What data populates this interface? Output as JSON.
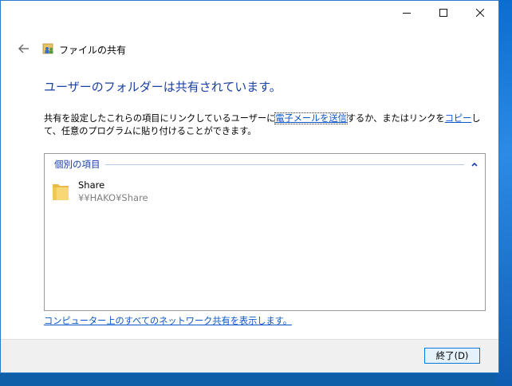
{
  "window": {
    "app_title": "ファイルの共有",
    "controls": {
      "minimize": "minimize",
      "maximize": "maximize",
      "close": "close"
    }
  },
  "main": {
    "heading": "ユーザーのフォルダーは共有されています。",
    "description": {
      "part1": "共有を設定したこれらの項目にリンクしているユーザーに",
      "email_link": "電子メールを送信",
      "part2": "するか、またはリンクを",
      "copy_link": "コピー",
      "part3": "して、任意のプログラムに貼り付けることができます。"
    },
    "group": {
      "label": "個別の項目",
      "items": [
        {
          "name": "Share",
          "path": "¥¥HAKO¥Share",
          "icon": "folder-icon"
        }
      ]
    },
    "footer_link": "コンピューター上のすべてのネットワーク共有を表示します。"
  },
  "footer": {
    "finish_label": "終了(D)"
  },
  "colors": {
    "heading": "#1a3fa3",
    "link": "#0a55c8",
    "button_border": "#0078d7"
  }
}
